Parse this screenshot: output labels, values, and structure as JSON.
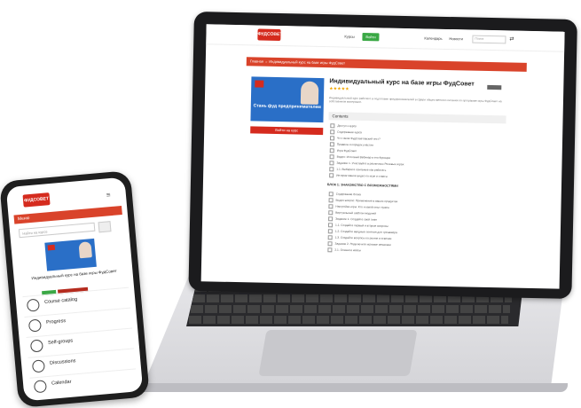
{
  "site": {
    "logo_text": "ФУДСОВЕТ",
    "nav": [
      "Курсы",
      "Войти"
    ],
    "header_links": [
      "Календарь",
      "Новости"
    ],
    "search_placeholder": "Поиск",
    "breadcrumb": "Главная → Индивидуальный курс на базе игры ФудСовет"
  },
  "course": {
    "title": "Индивидуальный курс на базе игры ФудСовет",
    "card_title": "Стань фуд предпринимателем",
    "card_button": "Войти на курс",
    "stars": "★★★★★",
    "description": "Индивидуальный курс рабочего в подготовке предпринимателей в сфере общественного питания по программе игры ФудСовет на собственном материале.",
    "content_header": "Contents",
    "lessons": [
      "Доступ к курсу",
      "Содержание курса",
      "Что такое ФудСоветовский тест?",
      "Правила и порядок участия",
      "Игра ФудСовет",
      "Видео: Итоговый Вебинар и его Функции",
      "Задание 1. Участвуйте в различных Ролевых играх",
      "1.1. Выберите основные как работать",
      "Интерактивное видео по игре и ответы"
    ],
    "section_title": "БЛОК 1: ЗНАКОМСТВО С ВОЗМОЖНОСТЯМИ",
    "section_lessons": [
      "Содержание блока",
      "Видео-вопрос: Применение в ваших продуктах",
      "Настройка игры: Кто и какой опыт нужен",
      "Виртуальный шаблон модулей",
      "Задание 1. Создайте свой план",
      "1.1. Создайте первый и вторые вопросы",
      "1.2. Создайте вводные понятия для тренажёра",
      "1.3. Создайте вопросы по ролям и ответам",
      "Задание 2. Подключите игровые механики",
      "2.1. Опишите кейсы"
    ]
  },
  "phone": {
    "menu_label": "Меню",
    "search_placeholder": "Найти на курсе",
    "course_title": "Индивидуальный курс на базе игры ФудСовет",
    "menu_items": [
      {
        "label": "Course catalog",
        "icon": "catalog-icon"
      },
      {
        "label": "Progress",
        "icon": "progress-icon"
      },
      {
        "label": "Self-groups",
        "icon": "group-icon"
      },
      {
        "label": "Discussions",
        "icon": "discussion-icon"
      },
      {
        "label": "Calendar",
        "icon": "calendar-icon"
      }
    ]
  },
  "colors": {
    "accent_red": "#d9432a",
    "brand_blue": "#2a6fc7",
    "green": "#3aa845"
  }
}
